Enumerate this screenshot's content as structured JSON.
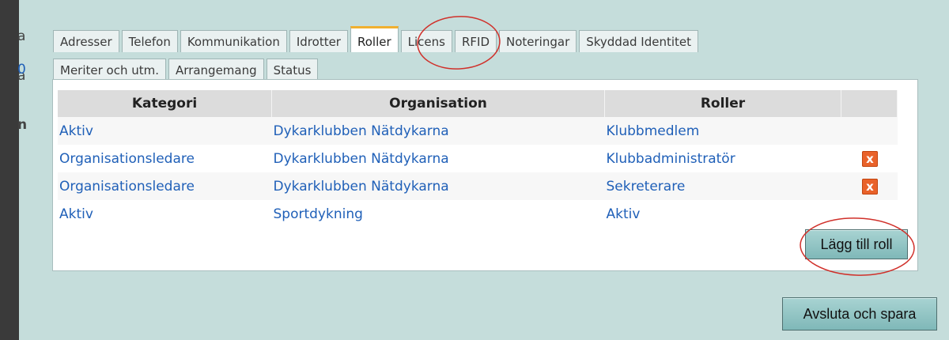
{
  "left_fragments": [
    "a",
    "0",
    "n"
  ],
  "tabs_row1": [
    {
      "label": "Adresser",
      "active": false
    },
    {
      "label": "Telefon",
      "active": false
    },
    {
      "label": "Kommunikation",
      "active": false
    },
    {
      "label": "Idrotter",
      "active": false
    },
    {
      "label": "Roller",
      "active": true
    },
    {
      "label": "Licens",
      "active": false
    },
    {
      "label": "RFID",
      "active": false
    },
    {
      "label": "Noteringar",
      "active": false
    },
    {
      "label": "Skyddad Identitet",
      "active": false
    }
  ],
  "tabs_row2": [
    {
      "label": "Meriter och utm.",
      "active": false
    },
    {
      "label": "Arrangemang",
      "active": false
    },
    {
      "label": "Status",
      "active": false
    }
  ],
  "table": {
    "headers": [
      "Kategori",
      "Organisation",
      "Roller",
      ""
    ],
    "rows": [
      {
        "kategori": "Aktiv",
        "organisation": "Dykarklubben Nätdykarna",
        "roll": "Klubbmedlem",
        "deletable": false
      },
      {
        "kategori": "Organisationsledare",
        "organisation": "Dykarklubben Nätdykarna",
        "roll": "Klubbadministratör",
        "deletable": true
      },
      {
        "kategori": "Organisationsledare",
        "organisation": "Dykarklubben Nätdykarna",
        "roll": "Sekreterare",
        "deletable": true
      },
      {
        "kategori": "Aktiv",
        "organisation": "Sportdykning",
        "roll": "Aktiv",
        "deletable": false
      }
    ],
    "delete_glyph": "x"
  },
  "buttons": {
    "add_role": "Lägg till roll",
    "save_and_close": "Avsluta och spara"
  },
  "colors": {
    "background": "#c5dddb",
    "link": "#2060b8",
    "delete": "#e9622a",
    "annotation": "#d0302a",
    "active_tab_accent": "#f0b030"
  }
}
